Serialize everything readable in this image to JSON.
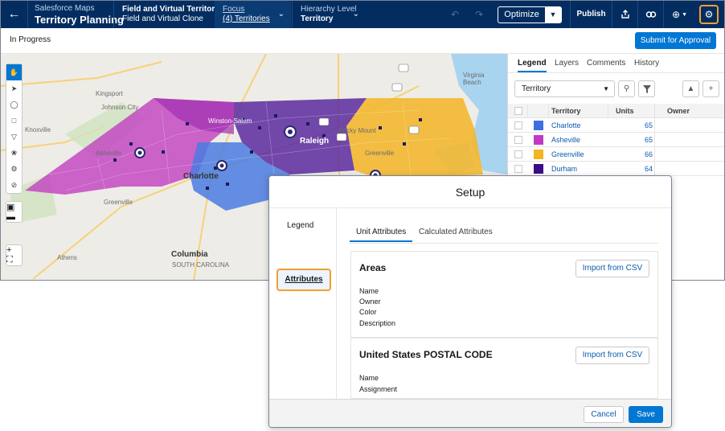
{
  "header": {
    "app_sub": "Salesforce Maps",
    "app_title": "Territory Planning",
    "plan_line1": "Field and Virtual Territories",
    "plan_line2": "Field and Virtual Clone",
    "focus_label": "Focus",
    "focus_value": "(4) Territories",
    "hierarchy_label": "Hierarchy Level",
    "hierarchy_value": "Territory",
    "optimize_label": "Optimize",
    "publish_label": "Publish"
  },
  "status": {
    "state": "In Progress",
    "submit_label": "Submit for Approval"
  },
  "map": {
    "labels": [
      {
        "text": "Kingsport"
      },
      {
        "text": "Johnson City"
      },
      {
        "text": "Knoxville"
      },
      {
        "text": "Asheville"
      },
      {
        "text": "Charlotte"
      },
      {
        "text": "Winston-Salem"
      },
      {
        "text": "Raleigh"
      },
      {
        "text": "Rocky Mount"
      },
      {
        "text": "Greenville"
      },
      {
        "text": "Greenville"
      },
      {
        "text": "Athens"
      },
      {
        "text": "Columbia"
      },
      {
        "text": "SOUTH CAROLINA"
      },
      {
        "text": "Virginia Beach"
      }
    ],
    "territory_colors": {
      "charlotte": "#4a7de0",
      "asheville": "#c040c0",
      "greenville": "#f2b830",
      "durham": "#4a1a8c"
    }
  },
  "panel": {
    "tabs": [
      "Legend",
      "Layers",
      "Comments",
      "History"
    ],
    "active_tab": "Legend",
    "select_value": "Territory",
    "columns": [
      "Territory",
      "Units",
      "Owner"
    ],
    "rows": [
      {
        "name": "Charlotte",
        "units": "65",
        "color": "#3d6fe0"
      },
      {
        "name": "Asheville",
        "units": "65",
        "color": "#c13ac1"
      },
      {
        "name": "Greenville",
        "units": "66",
        "color": "#f2b520"
      },
      {
        "name": "Durham",
        "units": "64",
        "color": "#3b0c86"
      }
    ]
  },
  "modal": {
    "title": "Setup",
    "side_items": [
      "Legend",
      "Attributes"
    ],
    "active_side": "Attributes",
    "tabs": [
      "Unit Attributes",
      "Calculated Attributes"
    ],
    "active_tab": "Unit Attributes",
    "cards": [
      {
        "title": "Areas",
        "import_label": "Import from CSV",
        "fields": [
          "Name",
          "Owner",
          "Color",
          "Description"
        ]
      },
      {
        "title": "United States POSTAL CODE",
        "import_label": "Import from CSV",
        "fields": [
          "Name",
          "Assignment"
        ]
      }
    ],
    "cancel_label": "Cancel",
    "save_label": "Save"
  }
}
